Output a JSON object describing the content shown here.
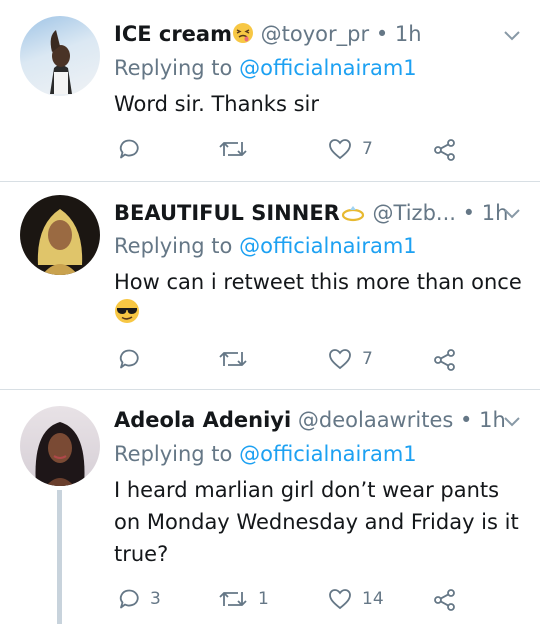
{
  "tweets": [
    {
      "name": "ICE cream",
      "name_emoji": "nauseated-face",
      "handle": "@toyor_pr",
      "dot": "•",
      "time": "1h",
      "replying_prefix": "Replying to",
      "replying_to": "@officialnairam1",
      "text": "Word sir. Thanks sir",
      "replies": "",
      "retweets": "",
      "likes": "7"
    },
    {
      "name": "BEAUTIFUL SINNER",
      "name_emoji": "ring",
      "handle": "@Tizb...",
      "dot": "•",
      "time": "1h",
      "replying_prefix": "Replying to",
      "replying_to": "@officialnairam1",
      "text": "How can i retweet this more than once",
      "text_emoji": "sunglasses-face",
      "replies": "",
      "retweets": "",
      "likes": "7"
    },
    {
      "name": "Adeola Adeniyi",
      "handle": "@deolaawrites",
      "dot": "•",
      "time": "1h",
      "replying_prefix": "Replying to",
      "replying_to": "@officialnairam1",
      "text": "I heard marlian girl don’t wear pants on Monday Wednesday and Friday is it true?",
      "replies": "3",
      "retweets": "1",
      "likes": "14"
    }
  ],
  "colors": {
    "text": "#14171a",
    "muted": "#657786",
    "link": "#1da1f2",
    "divider": "#d8dfe4",
    "thread": "#c8d3dc"
  },
  "icons": [
    "reply-icon",
    "retweet-icon",
    "like-icon",
    "share-icon",
    "chevron-down-icon"
  ]
}
